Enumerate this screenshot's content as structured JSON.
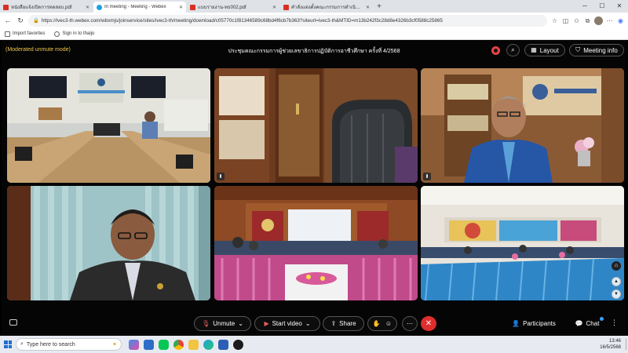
{
  "browser": {
    "tabs": [
      {
        "label": "หนังสือแจ้งเปิดการทดสอบ.pdf",
        "icon": "pdf-icon",
        "active": false
      },
      {
        "label": "In meeting - Meeting - Webex",
        "icon": "webex-icon",
        "active": true
      },
      {
        "label": "แบบรายงาน-ทธ002.pdf",
        "icon": "pdf-icon",
        "active": false
      },
      {
        "label": "คำสั่งแต่งตั้งคณะกรรมการดำเนินงาน.pdf",
        "icon": "pdf-icon",
        "active": false
      }
    ],
    "url": "https://ivec3-th.webex.com/wbxmjs/joinservice/sites/ivec3-th/meeting/download/c05770c1f81346589c68bd4f6cb7b363?siteurl=ivec3-th&MTID=m13b242f3c28d8e4326b3cf0588c25865",
    "bookmarks": [
      {
        "label": "Import favorites"
      },
      {
        "label": "Sign in to thaijo"
      }
    ]
  },
  "meeting": {
    "moderated_label": "(Moderated unmute mode)",
    "title": "ประชุมคณะกรรมการผู้ช่วยเลขาธิการปฏิบัติการอาชีวศึกษา ครั้งที่ 4/2568",
    "layout_label": "Layout",
    "info_label": "Meeting info"
  },
  "controls": {
    "unmute_label": "Unmute",
    "start_video_label": "Start video",
    "share_label": "Share",
    "participants_label": "Participants",
    "chat_label": "Chat"
  },
  "taskbar": {
    "search_placeholder": "Type here to search",
    "time": "13:46",
    "date": "16/5/2568"
  },
  "colors": {
    "accent_yellow": "#f0c64c",
    "leave_red": "#e02d2d",
    "record_red": "#e64343"
  }
}
